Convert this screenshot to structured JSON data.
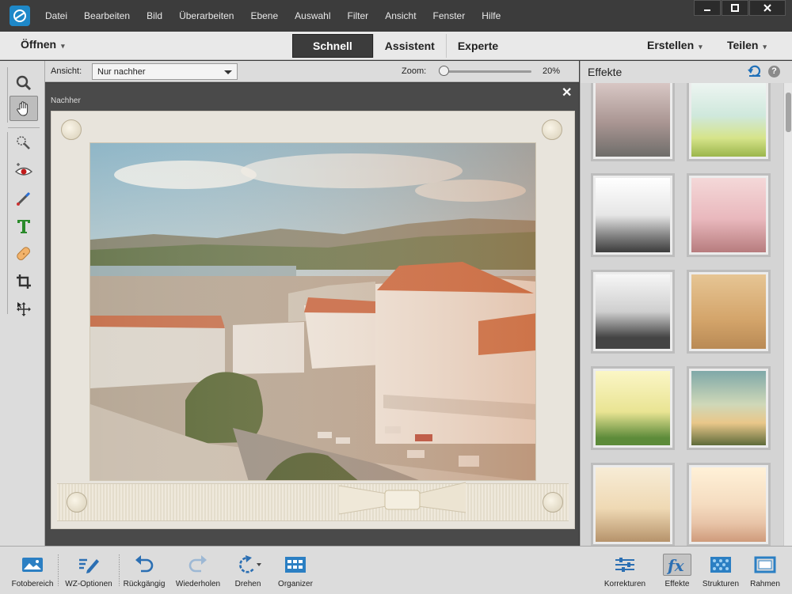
{
  "menu": [
    "Datei",
    "Bearbeiten",
    "Bild",
    "Überarbeiten",
    "Ebene",
    "Auswahl",
    "Filter",
    "Ansicht",
    "Fenster",
    "Hilfe"
  ],
  "modebar": {
    "open_label": "Öffnen",
    "tabs": [
      "Schnell",
      "Assistent",
      "Experte"
    ],
    "active_tab": "Schnell",
    "create_label": "Erstellen",
    "share_label": "Teilen"
  },
  "tools": [
    "zoom-icon",
    "hand-icon",
    "quick-selection-icon",
    "red-eye-icon",
    "whiten-teeth-icon",
    "text-icon",
    "spot-healing-icon",
    "crop-icon",
    "move-icon"
  ],
  "options": {
    "view_label": "Ansicht:",
    "view_value": "Nur nachher",
    "zoom_label": "Zoom:",
    "zoom_value": "20%",
    "zoom_fraction": 0.03
  },
  "document": {
    "view_title": "Nachher",
    "close_symbol": "✕"
  },
  "panel": {
    "title": "Effekte",
    "help_symbol": "?",
    "thumbnail_count": 10
  },
  "bottombar": {
    "left": [
      {
        "label": "Fotobereich",
        "icon": "photo-bin-icon"
      },
      {
        "label": "WZ-Optionen",
        "icon": "tool-options-icon"
      },
      {
        "label": "Rückgängig",
        "icon": "undo-icon"
      },
      {
        "label": "Wiederholen",
        "icon": "redo-icon"
      },
      {
        "label": "Drehen",
        "icon": "rotate-icon"
      },
      {
        "label": "Organizer",
        "icon": "organizer-icon"
      }
    ],
    "right": [
      {
        "label": "Korrekturen",
        "icon": "adjustments-icon"
      },
      {
        "label": "Effekte",
        "icon": "effects-icon"
      },
      {
        "label": "Strukturen",
        "icon": "textures-icon"
      },
      {
        "label": "Rahmen",
        "icon": "frames-icon"
      }
    ],
    "active": "Effekte"
  },
  "colors": {
    "accent": "#1e88c8",
    "titlebar": "#3c3c3c",
    "panel": "#dcdcdc",
    "canvas": "#4a4a4a"
  }
}
